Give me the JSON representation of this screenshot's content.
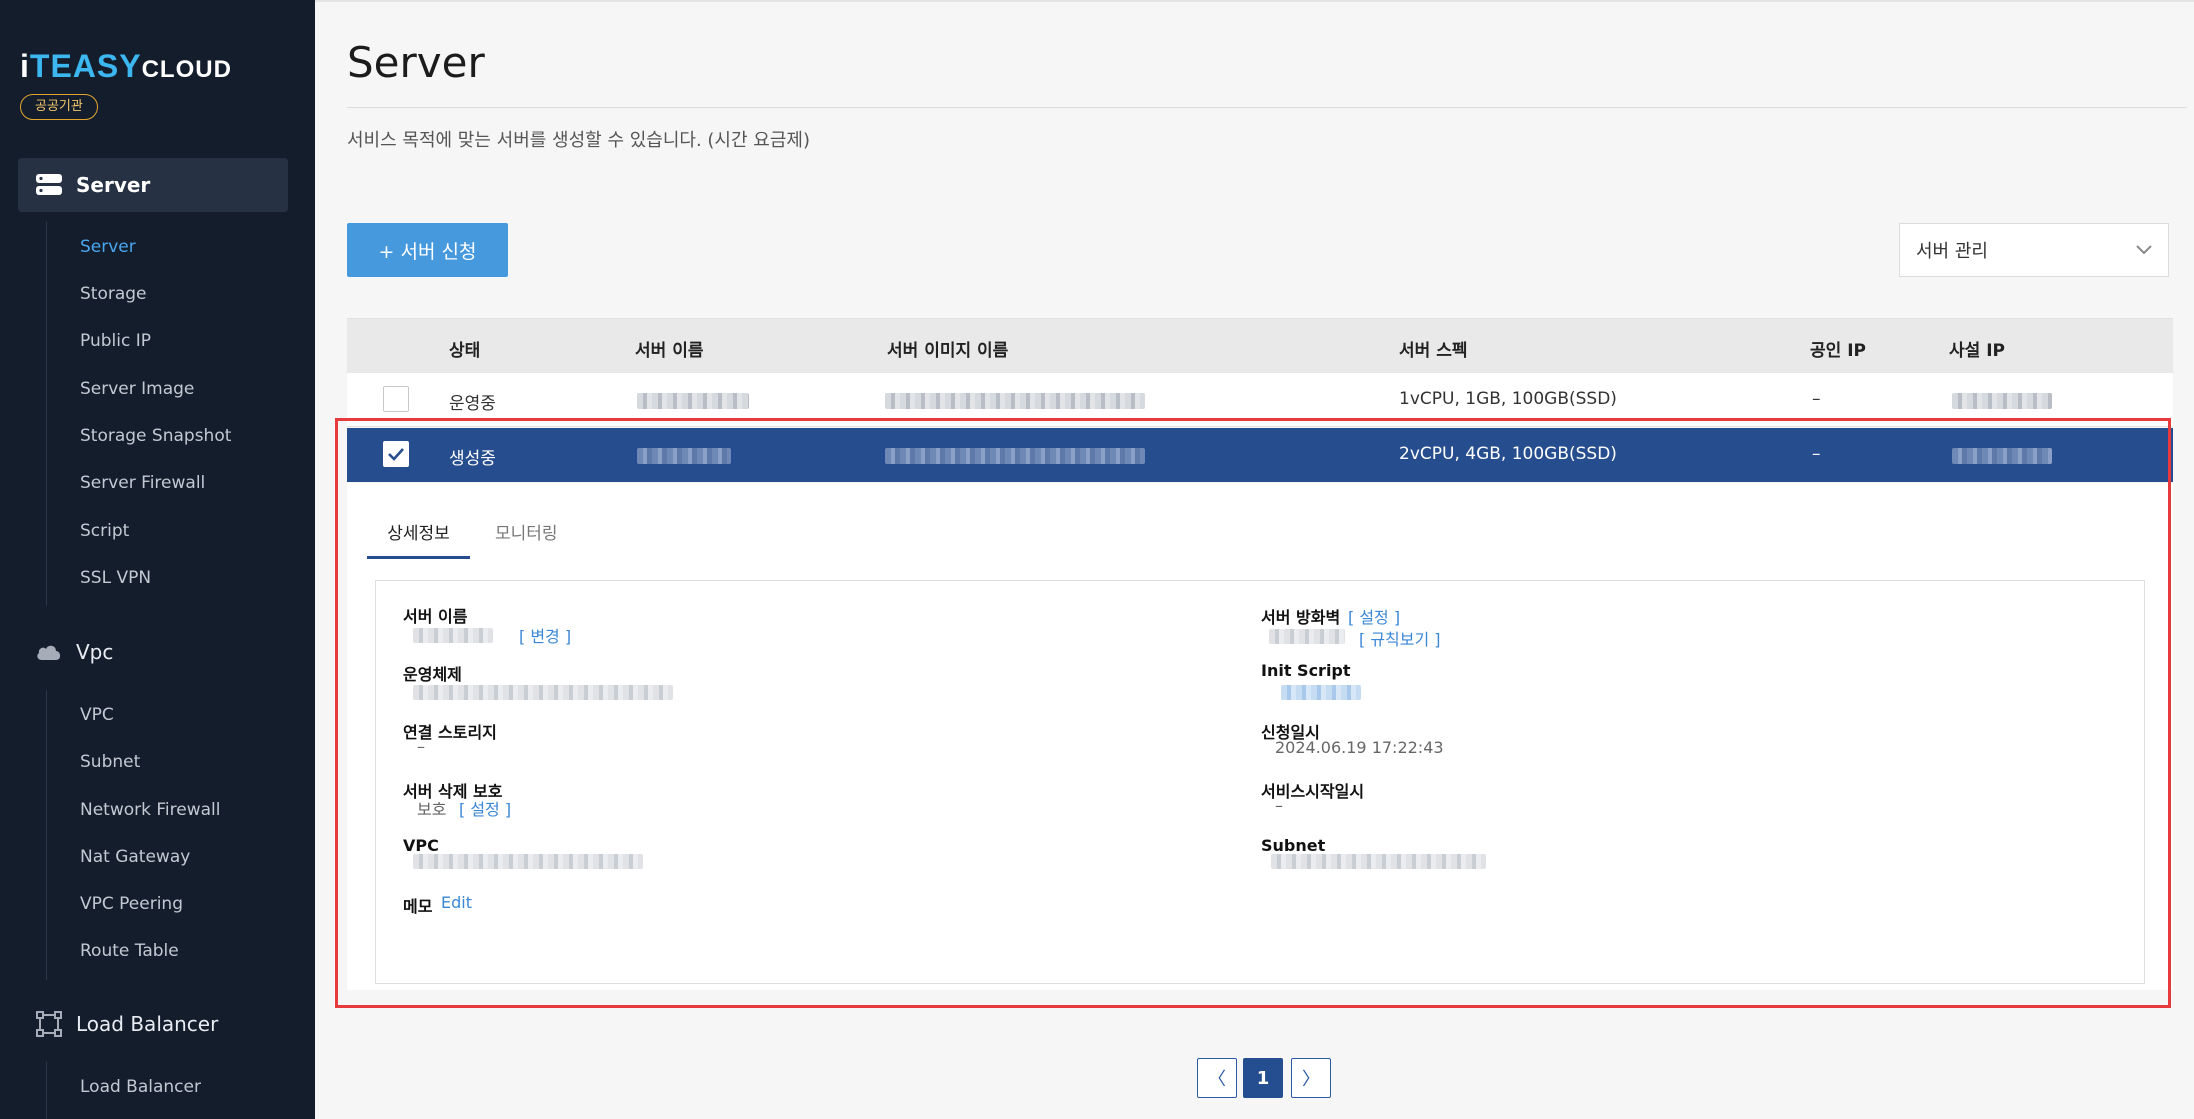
{
  "brand": {
    "logo_i": "i",
    "logo_teasy": "TEASY",
    "logo_cloud": "CLOUD",
    "badge": "공공기관",
    "accent_color": "#3db7f0"
  },
  "sidebar": {
    "groups": [
      {
        "label": "Server",
        "icon": "server-icon",
        "active": true,
        "items": [
          "Server",
          "Storage",
          "Public IP",
          "Server Image",
          "Storage Snapshot",
          "Server Firewall",
          "Script",
          "SSL VPN"
        ]
      },
      {
        "label": "Vpc",
        "icon": "cloud-icon",
        "active": false,
        "items": [
          "VPC",
          "Subnet",
          "Network Firewall",
          "Nat Gateway",
          "VPC Peering",
          "Route Table"
        ]
      },
      {
        "label": "Load Balancer",
        "icon": "load-balancer-icon",
        "active": false,
        "items": [
          "Load Balancer"
        ]
      }
    ],
    "active_item": "Server"
  },
  "page": {
    "title": "Server",
    "description": "서비스 목적에 맞는 서버를 생성할 수 있습니다. (시간 요금제)",
    "apply_button": "+ 서버 신청",
    "manage_select": "서버 관리"
  },
  "table": {
    "headers": [
      "상태",
      "서버 이름",
      "서버 이미지 이름",
      "서버 스펙",
      "공인 IP",
      "사설 IP"
    ],
    "rows": [
      {
        "status": "운영중",
        "spec": "1vCPU, 1GB, 100GB(SSD)",
        "public_ip": "–",
        "checked": false
      },
      {
        "status": "생성중",
        "spec": "2vCPU, 4GB, 100GB(SSD)",
        "public_ip": "–",
        "checked": true
      }
    ],
    "selected_color": "#264e8e"
  },
  "detail": {
    "tabs": [
      "상세정보",
      "모니터링"
    ],
    "active_tab": "상세정보",
    "left": {
      "server_name_label": "서버 이름",
      "server_name_change": "[ 변경 ]",
      "os_label": "운영체제",
      "storage_label": "연결 스토리지",
      "storage_value": "–",
      "protect_label": "서버 삭제 보호",
      "protect_value": "보호",
      "protect_setting": "[ 설정 ]",
      "vpc_label": "VPC",
      "memo_label": "메모",
      "memo_edit": "Edit"
    },
    "right": {
      "firewall_label": "서버 방화벽",
      "firewall_setting": "[ 설정 ]",
      "firewall_rules": "[ 규칙보기 ]",
      "init_script_label": "Init Script",
      "requested_label": "신청일시",
      "requested_value": "2024.06.19 17:22:43",
      "service_start_label": "서비스시작일시",
      "service_start_value": "–",
      "subnet_label": "Subnet"
    }
  },
  "pagination": {
    "prev": "〈",
    "current": "1",
    "next": "〉"
  },
  "highlight_color": "#e63a3f"
}
